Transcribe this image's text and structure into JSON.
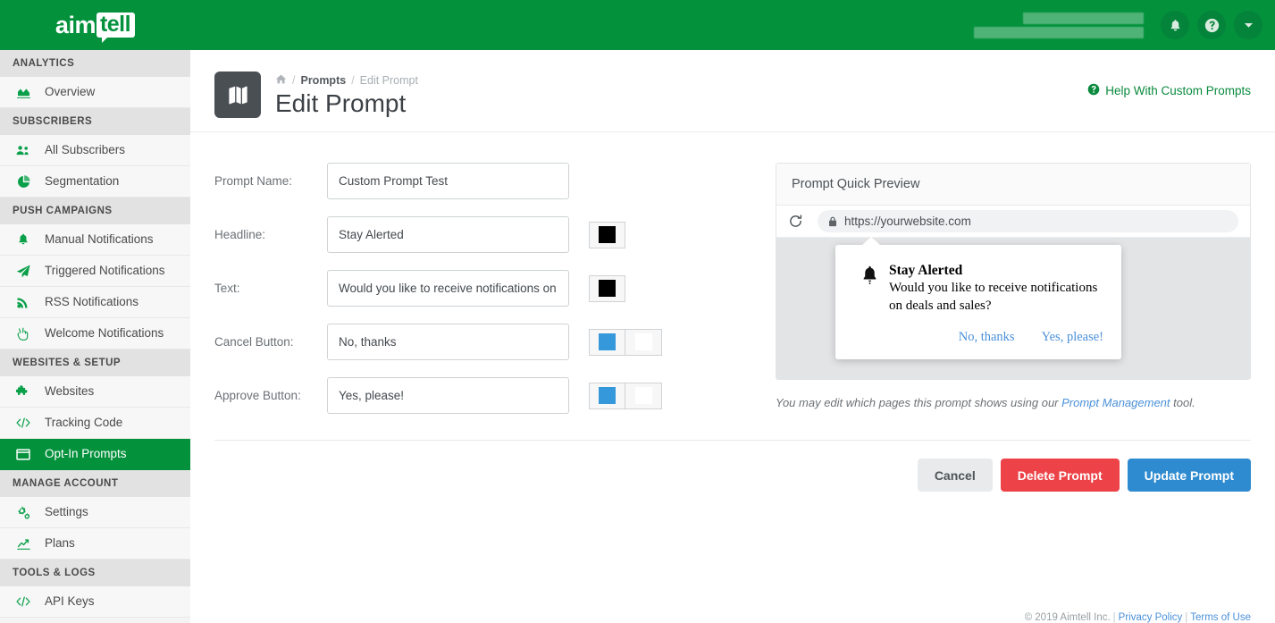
{
  "brand": {
    "logo_primary": "aim",
    "logo_secondary": "tell",
    "green": "#03913c"
  },
  "topbar": {
    "account_email_redacted": "",
    "account_url_redacted": "",
    "notifications_icon": "bell-icon",
    "help_icon": "question-circle-icon",
    "dropdown_icon": "caret-down-icon"
  },
  "sidebar": {
    "sections": [
      {
        "label": "ANALYTICS",
        "items": [
          {
            "label": "Overview",
            "icon": "area-chart-icon",
            "active": false
          }
        ]
      },
      {
        "label": "SUBSCRIBERS",
        "items": [
          {
            "label": "All Subscribers",
            "icon": "users-icon",
            "active": false
          },
          {
            "label": "Segmentation",
            "icon": "pie-chart-icon",
            "active": false
          }
        ]
      },
      {
        "label": "PUSH CAMPAIGNS",
        "items": [
          {
            "label": "Manual Notifications",
            "icon": "bell-icon",
            "active": false
          },
          {
            "label": "Triggered Notifications",
            "icon": "paper-plane-icon",
            "active": false
          },
          {
            "label": "RSS Notifications",
            "icon": "rss-icon",
            "active": false
          },
          {
            "label": "Welcome Notifications",
            "icon": "hand-peace-icon",
            "active": false
          }
        ]
      },
      {
        "label": "WEBSITES & SETUP",
        "items": [
          {
            "label": "Websites",
            "icon": "puzzle-piece-icon",
            "active": false
          },
          {
            "label": "Tracking Code",
            "icon": "code-icon",
            "active": false
          },
          {
            "label": "Opt-In Prompts",
            "icon": "window-icon",
            "active": true
          }
        ]
      },
      {
        "label": "MANAGE ACCOUNT",
        "items": [
          {
            "label": "Settings",
            "icon": "cogs-icon",
            "active": false
          },
          {
            "label": "Plans",
            "icon": "line-chart-icon",
            "active": false
          }
        ]
      },
      {
        "label": "TOOLS & LOGS",
        "items": [
          {
            "label": "API Keys",
            "icon": "code-icon",
            "active": false
          }
        ]
      }
    ]
  },
  "page": {
    "icon": "map-icon",
    "breadcrumb": {
      "home_icon": "home-icon",
      "items": [
        "Prompts",
        "Edit Prompt"
      ]
    },
    "title": "Edit Prompt",
    "help_link": "Help With Custom Prompts",
    "help_icon": "question-circle-icon"
  },
  "form": {
    "fields": [
      {
        "label": "Prompt Name:",
        "value": "Custom Prompt Test",
        "swatches": []
      },
      {
        "label": "Headline:",
        "value": "Stay Alerted",
        "swatches": [
          "#000000"
        ]
      },
      {
        "label": "Text:",
        "value": "Would you like to receive notifications on d",
        "swatches": [
          "#000000"
        ]
      },
      {
        "label": "Cancel Button:",
        "value": "No, thanks",
        "swatches": [
          "#3498db",
          "#ffffff"
        ]
      },
      {
        "label": "Approve Button:",
        "value": "Yes, please!",
        "swatches": [
          "#3498db",
          "#ffffff"
        ]
      }
    ]
  },
  "preview": {
    "title": "Prompt Quick Preview",
    "reload_icon": "reload-icon",
    "lock_icon": "lock-icon",
    "url": "https://yourwebsite.com",
    "popup": {
      "bell_icon": "bell-icon",
      "headline": "Stay Alerted",
      "text": "Would you like to receive notifications on deals and sales?",
      "cancel_label": "No, thanks",
      "approve_label": "Yes, please!"
    },
    "note_prefix": "You may edit which pages this prompt shows using our ",
    "note_link": "Prompt Management",
    "note_suffix": " tool."
  },
  "actions": {
    "cancel": "Cancel",
    "delete": "Delete Prompt",
    "update": "Update Prompt"
  },
  "footer": {
    "copyright": "© 2019 Aimtell Inc.",
    "privacy": "Privacy Policy",
    "terms": "Terms of Use"
  }
}
